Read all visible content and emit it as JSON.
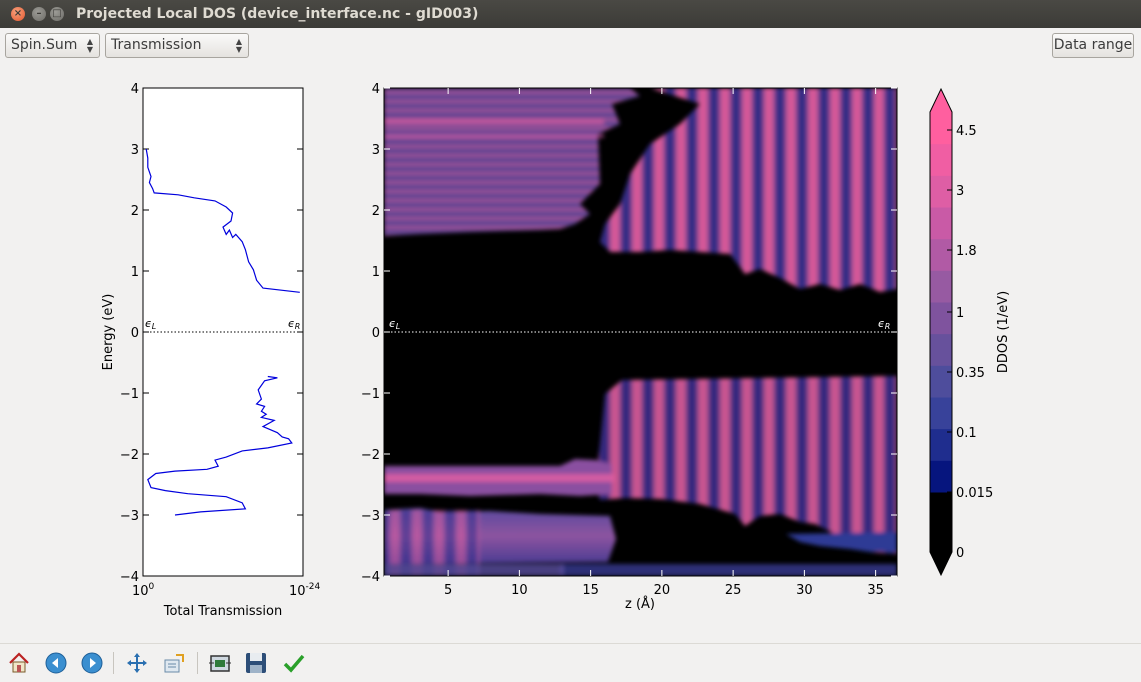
{
  "window": {
    "title": "Projected Local DOS (device_interface.nc - gID003)",
    "close_glyph": "×",
    "min_glyph": "–",
    "max_glyph": "□"
  },
  "toolbar": {
    "spin_selected": "Spin.Sum",
    "quantity_selected": "Transmission",
    "data_range_label": "Data range"
  },
  "left_plot": {
    "xlabel": "Total Transmission",
    "ylabel": "Energy (eV)",
    "x_tick_left": "10",
    "x_tick_left_exp": "0",
    "x_tick_right": "10",
    "x_tick_right_exp": "-24",
    "eps_left": "ϵ",
    "eps_left_sub": "L",
    "eps_right": "ϵ",
    "eps_right_sub": "R"
  },
  "main_plot": {
    "xlabel": "z (Å)",
    "colorbar_label": "DDOS (1/eV)",
    "eps_left": "ϵ",
    "eps_left_sub": "L",
    "eps_right": "ϵ",
    "eps_right_sub": "R"
  },
  "chart_data": [
    {
      "type": "line",
      "xlabel": "Total Transmission",
      "ylabel": "Energy (eV)",
      "x_scale": "log-reversed",
      "xlim": [
        "10^0",
        "10^-24"
      ],
      "ylim": [
        -4,
        4
      ],
      "yticks": [
        "4",
        "3",
        "2",
        "1",
        "0",
        "−1",
        "−2",
        "−3",
        "−4"
      ],
      "fermi_line": 0,
      "series": [
        {
          "segment": "upper",
          "points": [
            [
              0.02,
              3.0
            ],
            [
              0.03,
              2.85
            ],
            [
              0.03,
              2.7
            ],
            [
              0.05,
              2.55
            ],
            [
              0.04,
              2.45
            ],
            [
              0.06,
              2.35
            ],
            [
              0.07,
              2.28
            ],
            [
              0.22,
              2.25
            ],
            [
              0.32,
              2.2
            ],
            [
              0.45,
              2.15
            ],
            [
              0.52,
              2.05
            ],
            [
              0.56,
              1.95
            ],
            [
              0.55,
              1.82
            ],
            [
              0.5,
              1.72
            ],
            [
              0.52,
              1.6
            ],
            [
              0.54,
              1.67
            ],
            [
              0.56,
              1.55
            ],
            [
              0.58,
              1.6
            ],
            [
              0.62,
              1.48
            ],
            [
              0.64,
              1.35
            ],
            [
              0.66,
              1.15
            ],
            [
              0.69,
              1.02
            ],
            [
              0.71,
              0.85
            ],
            [
              0.75,
              0.72
            ],
            [
              0.98,
              0.65
            ]
          ]
        },
        {
          "segment": "lower",
          "points": [
            [
              0.78,
              -0.73
            ],
            [
              0.84,
              -0.75
            ],
            [
              0.76,
              -0.8
            ],
            [
              0.72,
              -0.95
            ],
            [
              0.74,
              -1.1
            ],
            [
              0.71,
              -1.18
            ],
            [
              0.76,
              -1.22
            ],
            [
              0.74,
              -1.3
            ],
            [
              0.77,
              -1.35
            ],
            [
              0.74,
              -1.4
            ],
            [
              0.82,
              -1.45
            ],
            [
              0.75,
              -1.55
            ],
            [
              0.84,
              -1.65
            ],
            [
              0.87,
              -1.72
            ],
            [
              0.91,
              -1.75
            ],
            [
              0.93,
              -1.82
            ],
            [
              0.78,
              -1.9
            ],
            [
              0.62,
              -1.95
            ],
            [
              0.52,
              -2.05
            ],
            [
              0.45,
              -2.1
            ],
            [
              0.47,
              -2.2
            ],
            [
              0.4,
              -2.25
            ],
            [
              0.2,
              -2.28
            ],
            [
              0.08,
              -2.32
            ],
            [
              0.03,
              -2.42
            ],
            [
              0.05,
              -2.55
            ],
            [
              0.14,
              -2.6
            ],
            [
              0.28,
              -2.65
            ],
            [
              0.52,
              -2.7
            ],
            [
              0.62,
              -2.8
            ],
            [
              0.64,
              -2.9
            ],
            [
              0.36,
              -2.95
            ],
            [
              0.2,
              -3.0
            ]
          ]
        }
      ]
    },
    {
      "type": "heatmap",
      "xlabel": "z (Å)",
      "ylabel": "",
      "xlim": [
        0.5,
        36.5
      ],
      "ylim": [
        -4,
        4
      ],
      "xticks": [
        "5",
        "10",
        "15",
        "20",
        "25",
        "30",
        "35"
      ],
      "yticks": [
        "4",
        "3",
        "2",
        "1",
        "0",
        "−1",
        "−2",
        "−3",
        "−4"
      ],
      "fermi_line": 0,
      "colorbar": {
        "label": "DDOS (1/eV)",
        "ticks": [
          "0",
          "0.015",
          "0.1",
          "0.35",
          "1",
          "1.8",
          "3",
          "4.5"
        ],
        "colors": [
          "#000000",
          "#06157e",
          "#1f2d8e",
          "#38429a",
          "#4e4d9c",
          "#67519c",
          "#7f539e",
          "#975aa2",
          "#b15aa5",
          "#c95aa6",
          "#de5ea5",
          "#f05ea3",
          "#ff5f9f"
        ]
      },
      "regions": [
        {
          "name": "upper-left band",
          "z": [
            0.5,
            17
          ],
          "E": [
            2.3,
            4.0
          ],
          "level": "0.35-1.8"
        },
        {
          "name": "upper-right band",
          "z": [
            16,
            36.5
          ],
          "E": [
            0.8,
            4.0
          ],
          "level": "1-4.5"
        },
        {
          "name": "lower-right band",
          "z": [
            17,
            36.5
          ],
          "E": [
            -2.9,
            -0.73
          ],
          "level": "1-3"
        },
        {
          "name": "lower-left strip",
          "z": [
            0.5,
            17
          ],
          "E": [
            -2.55,
            -2.2
          ],
          "level": "1-3"
        },
        {
          "name": "bottom-left band",
          "z": [
            0.5,
            17
          ],
          "E": [
            -4.0,
            -2.95
          ],
          "level": "0.35-1.8"
        },
        {
          "name": "bottom-right band",
          "z": [
            28,
            36.5
          ],
          "E": [
            -3.6,
            -2.9
          ],
          "level": "0.1-1"
        }
      ]
    }
  ],
  "bottom_toolbar": {
    "icons": [
      "home-icon",
      "back-icon",
      "forward-icon",
      "pan-icon",
      "zoom-icon",
      "subplots-icon",
      "save-icon",
      "apply-icon"
    ]
  }
}
